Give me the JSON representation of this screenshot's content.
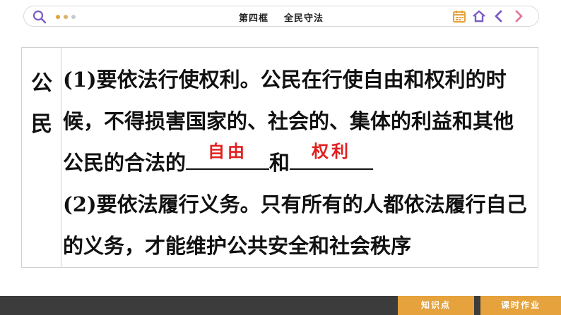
{
  "header": {
    "title": "第四框    全民守法",
    "icons": [
      "search-icon",
      "more-dots-icon",
      "calendar-icon",
      "home-icon",
      "back-arrow-icon",
      "forward-arrow-icon"
    ],
    "accent_color": "#e6a23c"
  },
  "table": {
    "side_label_line1": "公",
    "side_label_line2": "民",
    "lines": {
      "l1": "(1)要依法行使权利。公民在行使自由和权利的时",
      "l2": "候，不得损害国家的、社会的、集体的利益和其他",
      "l3_prefix": "公民的合法的",
      "blank1_answer": "自由",
      "l3_mid": "和",
      "blank2_answer": "权利",
      "l4": "(2)要依法履行义务。只有所有的人都依法履行自己",
      "l5": "的义务，才能维护公共安全和社会秩序"
    },
    "answer_color": "#e02020"
  },
  "footer": {
    "tab1": "知识点",
    "tab2": "课时作业"
  }
}
